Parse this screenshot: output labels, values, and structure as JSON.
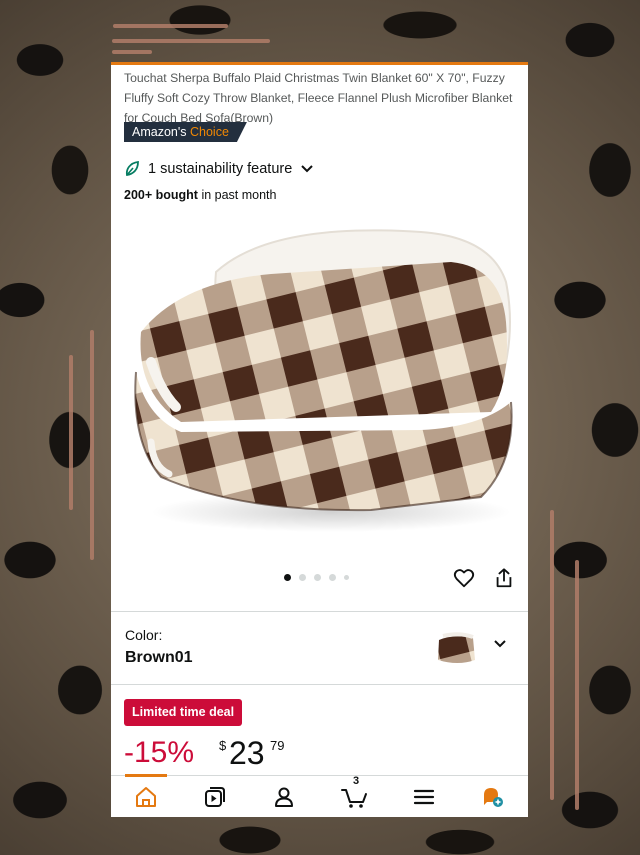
{
  "product": {
    "title": "Touchat Sherpa Buffalo Plaid Christmas Twin Blanket 60\" X 70\", Fuzzy Fluffy Soft Cozy Throw Blanket, Fleece Flannel Plush Microfiber Blanket for Couch Bed Sofa(Brown)",
    "badge_prefix": "Amazon's",
    "badge_accent": "Choice",
    "sustainability": "1 sustainability feature",
    "bought_bold": "200+ bought",
    "bought_rest": " in past month"
  },
  "gallery": {
    "image_count": 5,
    "active_index": 0
  },
  "variant": {
    "label": "Color:",
    "value": "Brown01"
  },
  "deal": {
    "badge": "Limited time deal",
    "discount": "-15%",
    "currency": "$",
    "price_whole": "23",
    "price_fraction": "79"
  },
  "nav": {
    "items": [
      "home-icon",
      "video-icon",
      "account-icon",
      "cart-icon",
      "menu-icon",
      "assistant-icon"
    ],
    "cart_count": "3",
    "active": "home-icon"
  },
  "colors": {
    "accent": "#e47911",
    "deal_red": "#cc0c39",
    "badge_dark": "#232f3e",
    "leaf_green": "#067d62"
  }
}
